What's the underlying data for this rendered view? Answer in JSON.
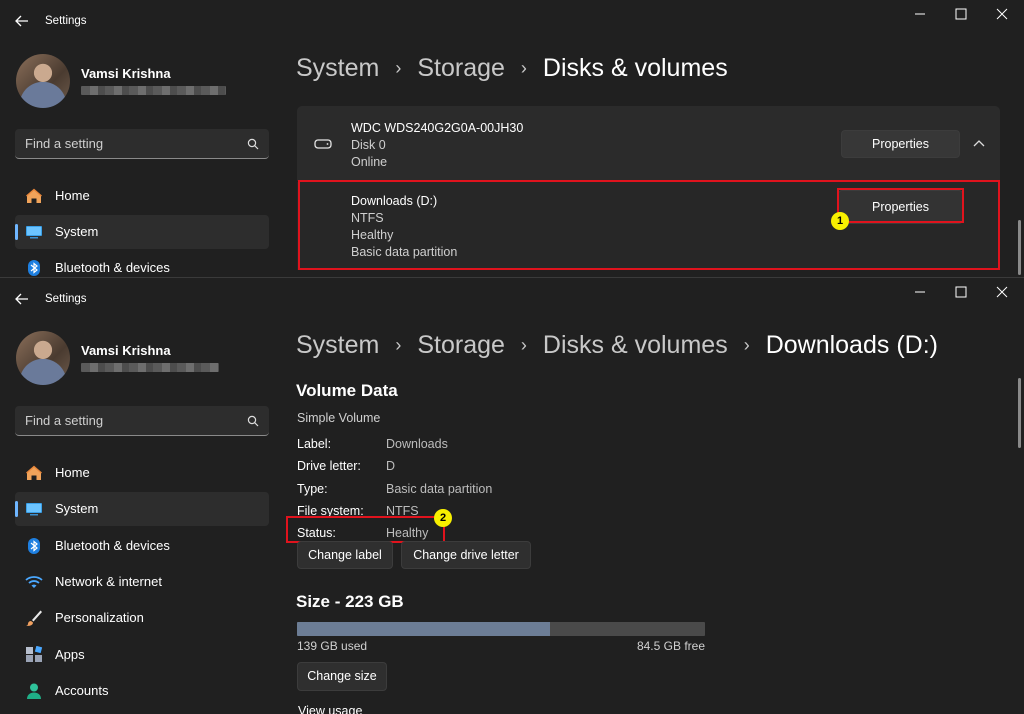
{
  "top_window": {
    "title": "Settings",
    "user": {
      "name": "Vamsi Krishna"
    },
    "search": {
      "placeholder": "Find a setting"
    },
    "nav": [
      {
        "label": "Home",
        "icon": "home-icon"
      },
      {
        "label": "System",
        "icon": "system-icon"
      },
      {
        "label": "Bluetooth & devices",
        "icon": "bluetooth-icon"
      }
    ],
    "breadcrumb": [
      "System",
      "Storage",
      "Disks & volumes"
    ],
    "disk": {
      "name": "WDC WDS240G2G0A-00JH30",
      "number": "Disk 0",
      "status": "Online",
      "properties_label": "Properties"
    },
    "partition": {
      "name": "Downloads (D:)",
      "filesystem": "NTFS",
      "health": "Healthy",
      "type": "Basic data partition",
      "properties_label": "Properties"
    },
    "badge": "1"
  },
  "bottom_window": {
    "title": "Settings",
    "user": {
      "name": "Vamsi Krishna"
    },
    "search": {
      "placeholder": "Find a setting"
    },
    "nav": [
      {
        "label": "Home",
        "icon": "home-icon"
      },
      {
        "label": "System",
        "icon": "system-icon"
      },
      {
        "label": "Bluetooth & devices",
        "icon": "bluetooth-icon"
      },
      {
        "label": "Network & internet",
        "icon": "wifi-icon"
      },
      {
        "label": "Personalization",
        "icon": "brush-icon"
      },
      {
        "label": "Apps",
        "icon": "apps-icon"
      },
      {
        "label": "Accounts",
        "icon": "account-icon"
      }
    ],
    "breadcrumb": [
      "System",
      "Storage",
      "Disks & volumes",
      "Downloads (D:)"
    ],
    "volume": {
      "title": "Volume Data",
      "subtitle": "Simple Volume",
      "props": [
        {
          "label": "Label:",
          "value": "Downloads"
        },
        {
          "label": "Drive letter:",
          "value": "D"
        },
        {
          "label": "Type:",
          "value": "Basic data partition"
        },
        {
          "label": "File system:",
          "value": "NTFS"
        },
        {
          "label": "Status:",
          "value": "Healthy"
        }
      ],
      "change_label": "Change label",
      "change_drive_letter": "Change drive letter"
    },
    "size": {
      "title": "Size - 223 GB",
      "used_fraction": 0.62,
      "used_text": "139 GB used",
      "free_text": "84.5 GB free",
      "change_size": "Change size",
      "view_usage": "View usage"
    },
    "badge": "2"
  },
  "colors": {
    "accent": "#6fb6ff",
    "highlight_red": "#e0131d",
    "badge_yellow": "#f8f000",
    "window_bg": "#202020",
    "bar_used": "#6c7d95"
  }
}
